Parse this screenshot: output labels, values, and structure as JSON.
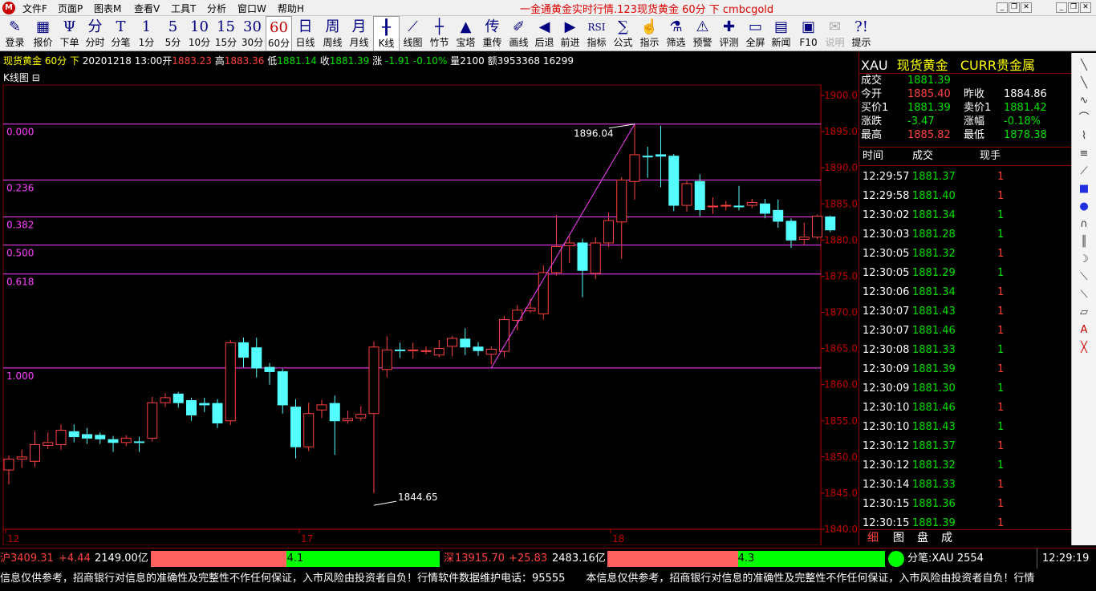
{
  "menu": {
    "items": [
      "文件F",
      "页面P",
      "图表M",
      "查看V",
      "工具T",
      "分析",
      "窗口W",
      "帮助H"
    ],
    "title": "一金通黄金实时行情.123现货黄金 60分 下 cmbcgold"
  },
  "toolbar": [
    {
      "icon": "✎",
      "label": "登录"
    },
    {
      "icon": "▦",
      "label": "报价"
    },
    {
      "icon": "Ψ",
      "label": "下单"
    },
    {
      "icon": "分",
      "label": "分时"
    },
    {
      "icon": "T",
      "label": "分笔"
    },
    {
      "icon": "1",
      "label": "1分"
    },
    {
      "icon": "5",
      "label": "5分"
    },
    {
      "icon": "10",
      "label": "10分"
    },
    {
      "icon": "15",
      "label": "15分"
    },
    {
      "icon": "30",
      "label": "30分"
    },
    {
      "icon": "60",
      "label": "60分"
    },
    {
      "icon": "日",
      "label": "日线"
    },
    {
      "icon": "周",
      "label": "周线"
    },
    {
      "icon": "月",
      "label": "月线"
    },
    {
      "icon": "╂",
      "label": "K线"
    },
    {
      "icon": "⟋",
      "label": "线图"
    },
    {
      "icon": "┼",
      "label": "竹节"
    },
    {
      "icon": "▲",
      "label": "宝塔"
    },
    {
      "icon": "传",
      "label": "重传"
    },
    {
      "icon": "✐",
      "label": "画线"
    },
    {
      "icon": "◀",
      "label": "后退"
    },
    {
      "icon": "▶",
      "label": "前进"
    },
    {
      "icon": "RSI",
      "label": "指标"
    },
    {
      "icon": "∑",
      "label": "公式"
    },
    {
      "icon": "☝",
      "label": "指示"
    },
    {
      "icon": "⚗",
      "label": "筛选"
    },
    {
      "icon": "⚠",
      "label": "预警"
    },
    {
      "icon": "✚",
      "label": "评测"
    },
    {
      "icon": "▭",
      "label": "全屏"
    },
    {
      "icon": "▤",
      "label": "新闻"
    },
    {
      "icon": "▣",
      "label": "F10"
    },
    {
      "icon": "✉",
      "label": "说明"
    },
    {
      "icon": "?!",
      "label": "提示"
    }
  ],
  "info": {
    "name": "现货黄金",
    "period": "60分",
    "dir": "下",
    "date": "20201218 13:00",
    "open_lbl": "开",
    "open": "1883.23",
    "high_lbl": "高",
    "high": "1883.36",
    "low_lbl": "低",
    "low": "1881.14",
    "close_lbl": "收",
    "close": "1881.39",
    "chg_lbl": "涨",
    "chg": "-1.91",
    "pct": "-0.10%",
    "vol_lbl": "量",
    "vol": "2100",
    "amt_lbl": "额",
    "amt": "3953368",
    "extra": "16299"
  },
  "chart_title": "K线图",
  "chart_data": {
    "type": "candlestick",
    "y_ticks": [
      "1900.0",
      "1895.0",
      "1890.0",
      "1885.0",
      "1880.0",
      "1875.0",
      "1870.0",
      "1865.0",
      "1860.0",
      "1855.0",
      "1850.0",
      "1845.0",
      "1840.0"
    ],
    "x_labels": [
      "12",
      "17",
      "18"
    ],
    "ylim": [
      1840,
      1900
    ],
    "fib_levels": [
      {
        "label": "0.000",
        "price": 1896.04
      },
      {
        "label": "0.236",
        "price": 1888.3
      },
      {
        "label": "0.382",
        "price": 1883.2
      },
      {
        "label": "0.500",
        "price": 1879.3
      },
      {
        "label": "0.618",
        "price": 1875.3
      },
      {
        "label": "1.000",
        "price": 1862.3
      }
    ],
    "annotations": [
      {
        "text": "1896.04",
        "price": 1896.04
      },
      {
        "text": "1844.65",
        "price": 1844.65
      }
    ],
    "candles": [
      [
        1848.2,
        1849.7,
        1846.2,
        1850.2
      ],
      [
        1849.7,
        1850.0,
        1848.5,
        1851.0
      ],
      [
        1849.4,
        1851.7,
        1848.6,
        1853.5
      ],
      [
        1851.6,
        1852.0,
        1851.1,
        1853.4
      ],
      [
        1851.7,
        1853.7,
        1851.0,
        1854.5
      ],
      [
        1853.5,
        1852.8,
        1852.0,
        1854.5
      ],
      [
        1853.1,
        1852.6,
        1851.8,
        1854.0
      ],
      [
        1853.0,
        1852.5,
        1851.8,
        1853.4
      ],
      [
        1852.4,
        1852.0,
        1850.7,
        1852.9
      ],
      [
        1852.0,
        1852.6,
        1851.5,
        1853.0
      ],
      [
        1852.1,
        1852.0,
        1850.7,
        1852.8
      ],
      [
        1852.6,
        1857.5,
        1852.1,
        1858.3
      ],
      [
        1857.5,
        1858.2,
        1856.9,
        1858.8
      ],
      [
        1858.7,
        1857.5,
        1856.8,
        1859.0
      ],
      [
        1857.8,
        1855.8,
        1855.0,
        1858.2
      ],
      [
        1857.4,
        1857.2,
        1856.2,
        1858.2
      ],
      [
        1857.4,
        1854.7,
        1854.0,
        1858.0
      ],
      [
        1855.0,
        1865.8,
        1854.4,
        1866.2
      ],
      [
        1865.8,
        1863.8,
        1862.4,
        1866.5
      ],
      [
        1865.1,
        1862.3,
        1861.0,
        1866.5
      ],
      [
        1862.4,
        1861.8,
        1860.0,
        1863.0
      ],
      [
        1861.8,
        1857.2,
        1856.0,
        1862.2
      ],
      [
        1856.9,
        1851.4,
        1849.8,
        1858.0
      ],
      [
        1851.4,
        1856.0,
        1850.8,
        1857.5
      ],
      [
        1856.5,
        1857.2,
        1855.4,
        1857.9
      ],
      [
        1857.4,
        1855.0,
        1850.3,
        1858.5
      ],
      [
        1855.0,
        1855.3,
        1854.6,
        1856.4
      ],
      [
        1855.4,
        1855.9,
        1855.0,
        1857.0
      ],
      [
        1856.0,
        1865.2,
        1845.0,
        1866.0
      ],
      [
        1862.1,
        1864.8,
        1861.0,
        1866.7
      ],
      [
        1864.8,
        1864.7,
        1863.7,
        1865.8
      ],
      [
        1864.7,
        1864.8,
        1863.6,
        1865.8
      ],
      [
        1864.6,
        1864.7,
        1864.2,
        1865.3
      ],
      [
        1864.1,
        1865.0,
        1863.8,
        1866.2
      ],
      [
        1865.3,
        1866.4,
        1863.9,
        1866.7
      ],
      [
        1866.3,
        1865.2,
        1864.1,
        1867.8
      ],
      [
        1865.2,
        1864.7,
        1864.0,
        1865.9
      ],
      [
        1864.2,
        1864.9,
        1862.8,
        1865.3
      ],
      [
        1864.6,
        1869.0,
        1863.8,
        1869.5
      ],
      [
        1868.9,
        1870.3,
        1867.5,
        1871.0
      ],
      [
        1870.2,
        1870.6,
        1869.9,
        1871.9
      ],
      [
        1869.8,
        1875.5,
        1869.0,
        1876.5
      ],
      [
        1875.5,
        1879.1,
        1875.1,
        1883.5
      ],
      [
        1879.2,
        1879.6,
        1876.8,
        1880.5
      ],
      [
        1879.6,
        1875.8,
        1872.1,
        1880.2
      ],
      [
        1875.4,
        1879.6,
        1874.6,
        1880.4
      ],
      [
        1879.6,
        1882.7,
        1879.0,
        1883.8
      ],
      [
        1882.5,
        1888.3,
        1877.4,
        1888.7
      ],
      [
        1888.1,
        1891.8,
        1885.6,
        1896.0
      ],
      [
        1891.6,
        1891.5,
        1888.6,
        1892.9
      ],
      [
        1891.8,
        1891.6,
        1887.3,
        1895.8
      ],
      [
        1891.6,
        1884.8,
        1884.0,
        1891.9
      ],
      [
        1884.8,
        1887.8,
        1883.9,
        1888.4
      ],
      [
        1888.1,
        1884.2,
        1883.3,
        1889.1
      ],
      [
        1884.6,
        1884.7,
        1883.6,
        1885.9
      ],
      [
        1884.7,
        1884.8,
        1884.1,
        1885.4
      ],
      [
        1884.7,
        1884.6,
        1884.1,
        1887.5
      ],
      [
        1884.8,
        1885.2,
        1884.4,
        1885.7
      ],
      [
        1885.0,
        1883.7,
        1883.0,
        1885.7
      ],
      [
        1884.1,
        1882.6,
        1881.7,
        1885.6
      ],
      [
        1882.6,
        1880.0,
        1878.9,
        1883.0
      ],
      [
        1880.1,
        1880.4,
        1879.3,
        1882.4
      ],
      [
        1880.4,
        1883.3,
        1880.1,
        1883.5
      ],
      [
        1883.2,
        1881.4,
        1881.1,
        1883.4
      ]
    ]
  },
  "right": {
    "code": "XAU",
    "name": "现货黄金",
    "market": "CURR贵金属",
    "rows": [
      {
        "l1": "成交",
        "v1": "1881.39",
        "c1": "grn",
        "l2": "",
        "v2": "",
        "c2": "grn"
      },
      {
        "l1": "今开",
        "v1": "1885.40",
        "c1": "red",
        "l2": "昨收",
        "v2": "1884.86",
        "c2": "wht"
      },
      {
        "l1": "买价1",
        "v1": "1881.39",
        "c1": "grn",
        "l2": "卖价1",
        "v2": "1881.42",
        "c2": "grn"
      },
      {
        "l1": "涨跌",
        "v1": "-3.47",
        "c1": "grn",
        "l2": "涨幅",
        "v2": "-0.18%",
        "c2": "grn"
      },
      {
        "l1": "最高",
        "v1": "1885.82",
        "c1": "red",
        "l2": "最低",
        "v2": "1878.38",
        "c2": "grn"
      }
    ],
    "ticks_header": {
      "time": "时间",
      "price": "成交",
      "vol": "现手"
    },
    "ticks": [
      {
        "t": "12:29:57",
        "p": "1881.37",
        "c": "grn",
        "v": "1",
        "vc": "red"
      },
      {
        "t": "12:29:58",
        "p": "1881.40",
        "c": "grn",
        "v": "1",
        "vc": "red"
      },
      {
        "t": "12:30:02",
        "p": "1881.34",
        "c": "grn",
        "v": "1",
        "vc": "grn"
      },
      {
        "t": "12:30:03",
        "p": "1881.28",
        "c": "grn",
        "v": "1",
        "vc": "grn"
      },
      {
        "t": "12:30:05",
        "p": "1881.32",
        "c": "grn",
        "v": "1",
        "vc": "red"
      },
      {
        "t": "12:30:05",
        "p": "1881.29",
        "c": "grn",
        "v": "1",
        "vc": "grn"
      },
      {
        "t": "12:30:06",
        "p": "1881.34",
        "c": "grn",
        "v": "1",
        "vc": "red"
      },
      {
        "t": "12:30:07",
        "p": "1881.43",
        "c": "grn",
        "v": "1",
        "vc": "red"
      },
      {
        "t": "12:30:07",
        "p": "1881.46",
        "c": "grn",
        "v": "1",
        "vc": "red"
      },
      {
        "t": "12:30:08",
        "p": "1881.33",
        "c": "grn",
        "v": "1",
        "vc": "grn"
      },
      {
        "t": "12:30:09",
        "p": "1881.39",
        "c": "grn",
        "v": "1",
        "vc": "red"
      },
      {
        "t": "12:30:09",
        "p": "1881.30",
        "c": "grn",
        "v": "1",
        "vc": "grn"
      },
      {
        "t": "12:30:10",
        "p": "1881.46",
        "c": "grn",
        "v": "1",
        "vc": "red"
      },
      {
        "t": "12:30:10",
        "p": "1881.43",
        "c": "grn",
        "v": "1",
        "vc": "grn"
      },
      {
        "t": "12:30:12",
        "p": "1881.37",
        "c": "grn",
        "v": "1",
        "vc": "red"
      },
      {
        "t": "12:30:12",
        "p": "1881.32",
        "c": "grn",
        "v": "1",
        "vc": "grn"
      },
      {
        "t": "12:30:14",
        "p": "1881.33",
        "c": "grn",
        "v": "1",
        "vc": "red"
      },
      {
        "t": "12:30:15",
        "p": "1881.36",
        "c": "grn",
        "v": "1",
        "vc": "red"
      },
      {
        "t": "12:30:15",
        "p": "1881.39",
        "c": "grn",
        "v": "1",
        "vc": "red"
      }
    ],
    "tabs": [
      "细",
      "图",
      "盘",
      "成"
    ]
  },
  "status": {
    "sh_lbl": "沪",
    "sh": "3409.31",
    "sh_chg": "+4.44",
    "sh_amt": "2149.00亿",
    "sh_ratio": "4.1",
    "sh_fill": 0.47,
    "sz_lbl": "深",
    "sz": "13915.70",
    "sz_chg": "+25.83",
    "sz_amt": "2483.16亿",
    "sz_ratio": "4.3",
    "sz_fill": 0.47,
    "fenbi": "分笔:XAU 2554",
    "time": "12:29:19"
  },
  "ticker": "信息仅供参考，招商银行对信息的准确性及完整性不作任何保证，入市风险由投资者自负！行情软件数据维护电话：95555　　本信息仅供参考，招商银行对信息的准确性及完整性不作任何保证，入市风险由投资者自负！行情",
  "colors": {
    "up": "#ff4040",
    "down": "#54ffff",
    "fib": "#ff40ff",
    "axis": "#c00000"
  }
}
